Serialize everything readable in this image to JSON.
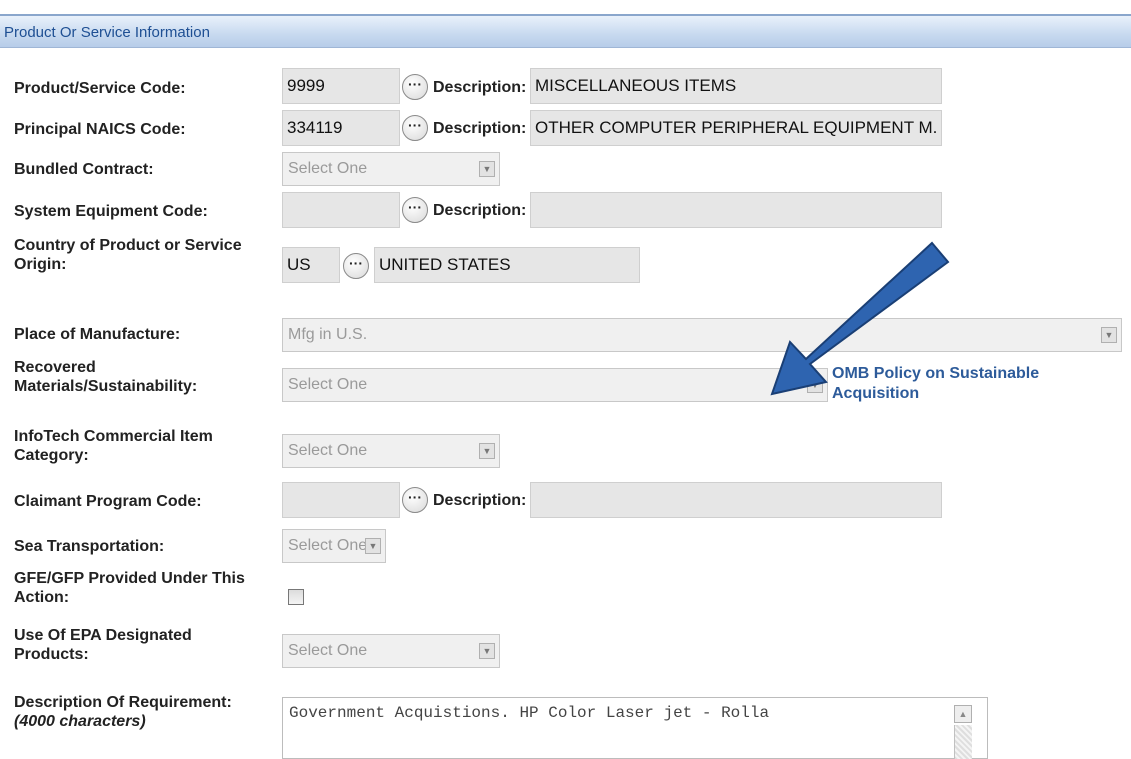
{
  "section_title": "Product Or Service Information",
  "fields": {
    "psc": {
      "label": "Product/Service Code:",
      "value": "9999",
      "desc_label": "Description:",
      "desc_value": "MISCELLANEOUS ITEMS"
    },
    "naics": {
      "label": "Principal NAICS Code:",
      "value": "334119",
      "desc_label": "Description:",
      "desc_value": "OTHER COMPUTER PERIPHERAL EQUIPMENT M."
    },
    "bundled": {
      "label": "Bundled Contract:",
      "value": "Select One"
    },
    "sec": {
      "label": "System Equipment Code:",
      "value": "",
      "desc_label": "Description:",
      "desc_value": ""
    },
    "country": {
      "label_line1": "Country of Product or Service",
      "label_line2": "Origin:",
      "code": "US",
      "name": "UNITED STATES"
    },
    "place": {
      "label": "Place of Manufacture:",
      "value": "Mfg in U.S."
    },
    "recovered": {
      "label_line1": "Recovered",
      "label_line2": "Materials/Sustainability:",
      "value": "Select One",
      "link_line1": "OMB Policy on  Sustainable",
      "link_line2": "Acquisition"
    },
    "infotech": {
      "label_line1": "InfoTech Commercial Item",
      "label_line2": "Category:",
      "value": "Select One"
    },
    "claimant": {
      "label": "Claimant Program Code:",
      "value": "",
      "desc_label": "Description:",
      "desc_value": ""
    },
    "sea": {
      "label": "Sea Transportation:",
      "value": "Select One"
    },
    "gfe": {
      "label_line1": "GFE/GFP Provided Under This",
      "label_line2": "Action:",
      "checked": false
    },
    "epa": {
      "label_line1": "Use Of EPA Designated",
      "label_line2": "Products:",
      "value": "Select One"
    },
    "description": {
      "label_line1": "Description Of Requirement:",
      "label_line2": "(4000 characters)",
      "value": "Government Acquistions.  HP Color Laser jet - Rolla"
    }
  },
  "annotation": {
    "arrow_color": "#2e64b0",
    "icon": "arrow-icon"
  }
}
